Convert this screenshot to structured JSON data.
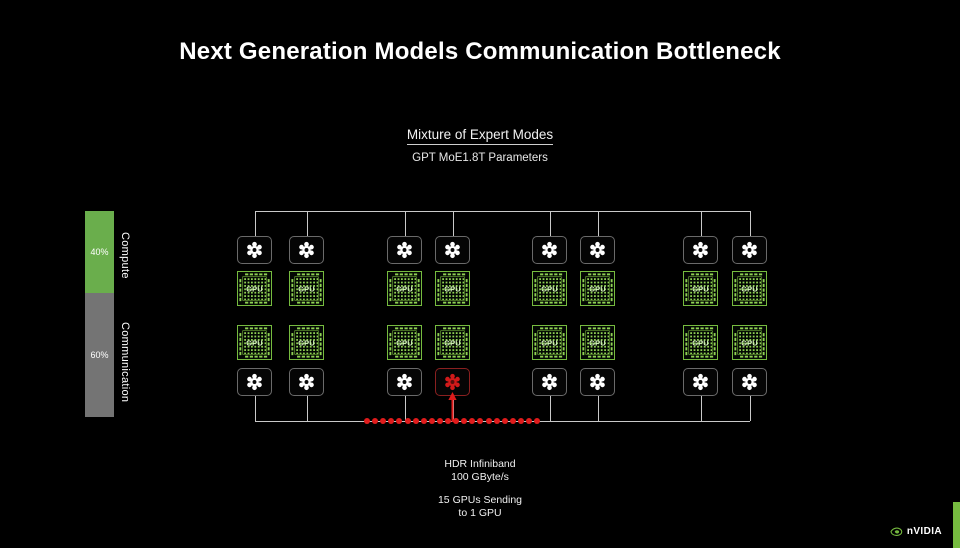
{
  "slide": {
    "title": "Next Generation Models Communication Bottleneck",
    "subtitle_heading": "Mixture of Expert Modes",
    "subtitle_sub": "GPT MoE1.8T Parameters"
  },
  "ratio_bar": {
    "segments": [
      {
        "name": "compute",
        "value_label": "40%",
        "axis_label": "Compute",
        "color": "#6aae4c",
        "percent": 40
      },
      {
        "name": "communication",
        "value_label": "60%",
        "axis_label": "Communication",
        "color": "#747474",
        "percent": 60
      }
    ]
  },
  "diagram": {
    "gpu_label": "GPU",
    "switch_icon": "network-switch-icon",
    "gpu_icon": "gpu-chip-icon",
    "groups": 4,
    "columns_per_group": 2,
    "gpu_rows": 2,
    "switch_rows": 2,
    "highlight": {
      "column_index": 4,
      "row": "bottom-switch",
      "color": "#e01b1b"
    },
    "link_color": "#c9c9c9",
    "gpu_border_color": "#76bb3f"
  },
  "captions": {
    "line1": "HDR Infiniband",
    "line2": "100 GByte/s",
    "line3": "15 GPUs Sending",
    "line4": "to 1 GPU"
  },
  "branding": {
    "wordmark": "nVIDIA",
    "accent_color": "#76bb3f"
  }
}
